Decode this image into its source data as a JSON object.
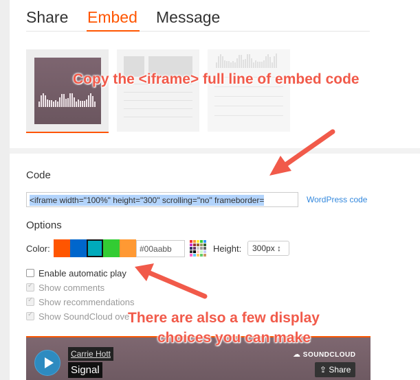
{
  "tabs": [
    {
      "label": "Share",
      "active": false
    },
    {
      "label": "Embed",
      "active": true
    },
    {
      "label": "Message",
      "active": false
    }
  ],
  "code": {
    "label": "Code",
    "value": "<iframe width=\"100%\" height=\"300\" scrolling=\"no\" frameborder=",
    "wordpress_link": "WordPress code"
  },
  "options": {
    "label": "Options",
    "color_label": "Color:",
    "swatches": [
      "#ff5500",
      "#0066cc",
      "#00aabb",
      "#33cc33",
      "#ff9933"
    ],
    "color_value": "#00aabb",
    "height_label": "Height:",
    "height_value": "300px ↕",
    "checkboxes": [
      {
        "label": "Enable automatic play",
        "checked": false,
        "disabled": false
      },
      {
        "label": "Show comments",
        "checked": true,
        "disabled": true
      },
      {
        "label": "Show recommendations",
        "checked": true,
        "disabled": true
      },
      {
        "label": "Show SoundCloud ove",
        "checked": true,
        "disabled": true
      }
    ]
  },
  "player": {
    "artist": "Carrie Hott",
    "track": "Signal",
    "logo_text": "SOUNDCLOUD",
    "share_label": "Share"
  },
  "annotations": {
    "callout_top": "Copy the <iframe> full line of embed code",
    "callout_bottom_line1": "There are also a few display",
    "callout_bottom_line2": "choices you can make"
  },
  "colors": {
    "accent": "#ff5500",
    "link": "#3388dd",
    "annotation": "#f15a4a"
  }
}
